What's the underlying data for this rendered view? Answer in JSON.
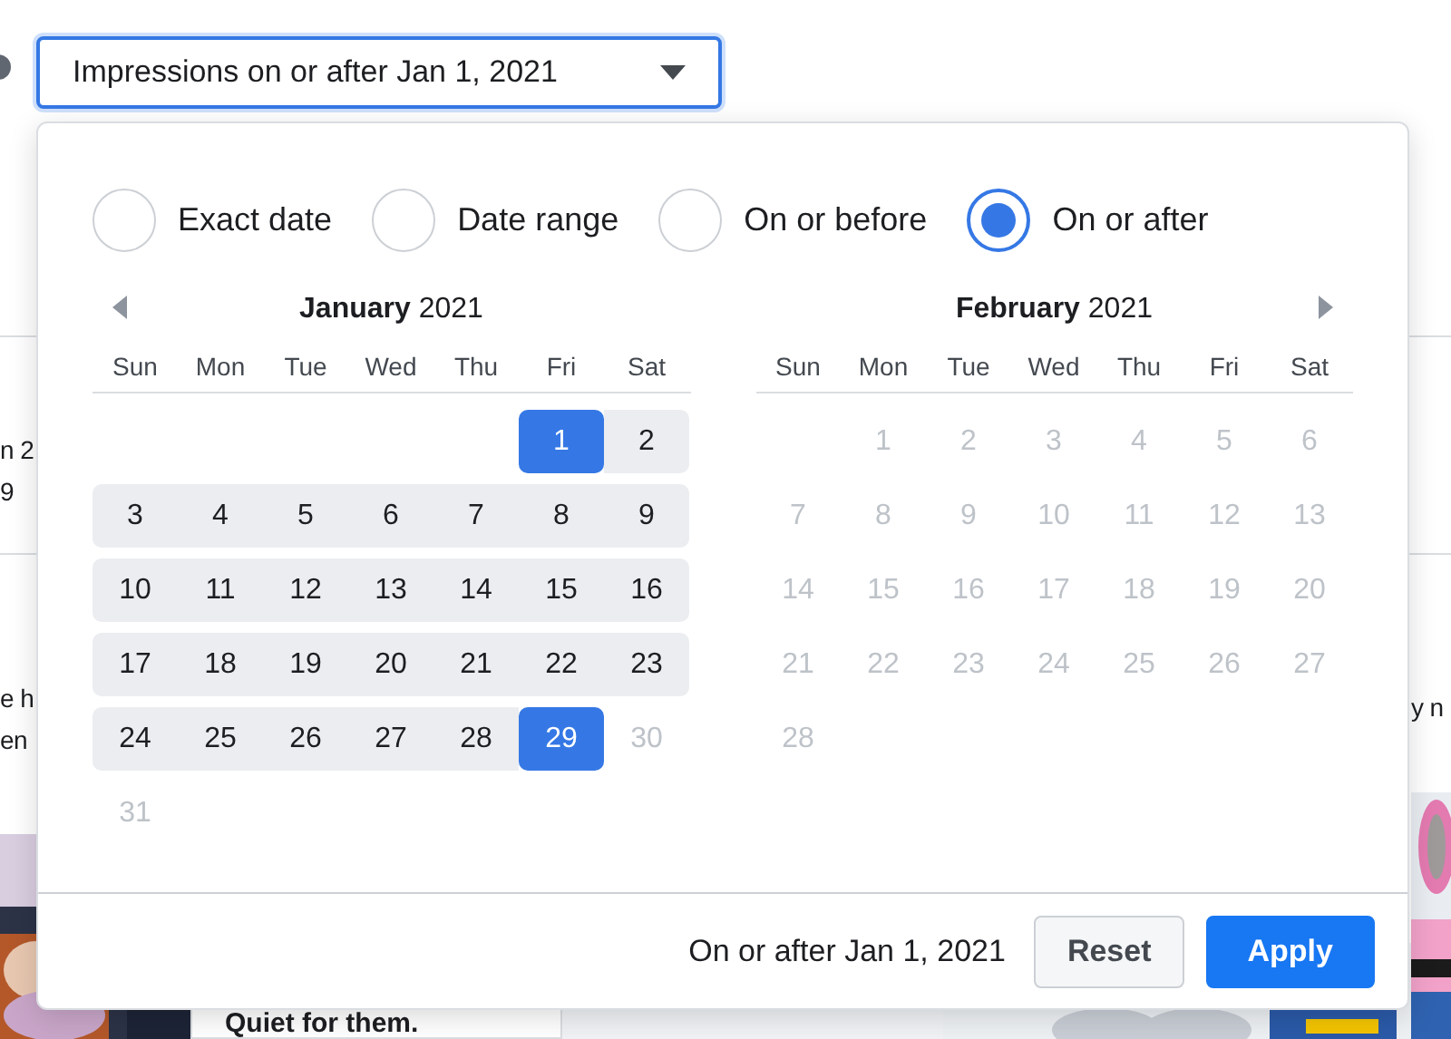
{
  "filter_button": {
    "label": "Impressions on or after Jan 1, 2021"
  },
  "modes": [
    {
      "label": "Exact date",
      "selected": false
    },
    {
      "label": "Date range",
      "selected": false
    },
    {
      "label": "On or before",
      "selected": false
    },
    {
      "label": "On or after",
      "selected": true
    }
  ],
  "calendars": [
    {
      "month": "January",
      "year": "2021",
      "prev_arrow": true,
      "weekdays": [
        "Sun",
        "Mon",
        "Tue",
        "Wed",
        "Thu",
        "Fri",
        "Sat"
      ],
      "weeks": [
        [
          {
            "day": "1",
            "selected": true,
            "disabled": false
          },
          {
            "day": "2",
            "selected": false,
            "disabled": false
          }
        ],
        [
          {
            "day": "3",
            "selected": false,
            "disabled": false
          },
          {
            "day": "4",
            "selected": false,
            "disabled": false
          },
          {
            "day": "5",
            "selected": false,
            "disabled": false
          },
          {
            "day": "6",
            "selected": false,
            "disabled": false
          },
          {
            "day": "7",
            "selected": false,
            "disabled": false
          },
          {
            "day": "8",
            "selected": false,
            "disabled": false
          },
          {
            "day": "9",
            "selected": false,
            "disabled": false
          }
        ],
        [
          {
            "day": "10",
            "selected": false,
            "disabled": false
          },
          {
            "day": "11",
            "selected": false,
            "disabled": false
          },
          {
            "day": "12",
            "selected": false,
            "disabled": false
          },
          {
            "day": "13",
            "selected": false,
            "disabled": false
          },
          {
            "day": "14",
            "selected": false,
            "disabled": false
          },
          {
            "day": "15",
            "selected": false,
            "disabled": false
          },
          {
            "day": "16",
            "selected": false,
            "disabled": false
          }
        ],
        [
          {
            "day": "17",
            "selected": false,
            "disabled": false
          },
          {
            "day": "18",
            "selected": false,
            "disabled": false
          },
          {
            "day": "19",
            "selected": false,
            "disabled": false
          },
          {
            "day": "20",
            "selected": false,
            "disabled": false
          },
          {
            "day": "21",
            "selected": false,
            "disabled": false
          },
          {
            "day": "22",
            "selected": false,
            "disabled": false
          },
          {
            "day": "23",
            "selected": false,
            "disabled": false
          }
        ],
        [
          {
            "day": "24",
            "selected": false,
            "disabled": false
          },
          {
            "day": "25",
            "selected": false,
            "disabled": false
          },
          {
            "day": "26",
            "selected": false,
            "disabled": false
          },
          {
            "day": "27",
            "selected": false,
            "disabled": false
          },
          {
            "day": "28",
            "selected": false,
            "disabled": false
          },
          {
            "day": "29",
            "selected": true,
            "disabled": false
          },
          {
            "day": "30",
            "selected": false,
            "disabled": true
          }
        ],
        [
          {
            "day": "31",
            "selected": false,
            "disabled": true
          }
        ]
      ]
    },
    {
      "month": "February",
      "year": "2021",
      "next_arrow": true,
      "weekdays": [
        "Sun",
        "Mon",
        "Tue",
        "Wed",
        "Thu",
        "Fri",
        "Sat"
      ],
      "weeks": [
        [
          {
            "day": "1",
            "selected": false,
            "disabled": true
          },
          {
            "day": "2",
            "selected": false,
            "disabled": true
          },
          {
            "day": "3",
            "selected": false,
            "disabled": true
          },
          {
            "day": "4",
            "selected": false,
            "disabled": true
          },
          {
            "day": "5",
            "selected": false,
            "disabled": true
          },
          {
            "day": "6",
            "selected": false,
            "disabled": true
          }
        ],
        [
          {
            "day": "7",
            "selected": false,
            "disabled": true
          },
          {
            "day": "8",
            "selected": false,
            "disabled": true
          },
          {
            "day": "9",
            "selected": false,
            "disabled": true
          },
          {
            "day": "10",
            "selected": false,
            "disabled": true
          },
          {
            "day": "11",
            "selected": false,
            "disabled": true
          },
          {
            "day": "12",
            "selected": false,
            "disabled": true
          },
          {
            "day": "13",
            "selected": false,
            "disabled": true
          }
        ],
        [
          {
            "day": "14",
            "selected": false,
            "disabled": true
          },
          {
            "day": "15",
            "selected": false,
            "disabled": true
          },
          {
            "day": "16",
            "selected": false,
            "disabled": true
          },
          {
            "day": "17",
            "selected": false,
            "disabled": true
          },
          {
            "day": "18",
            "selected": false,
            "disabled": true
          },
          {
            "day": "19",
            "selected": false,
            "disabled": true
          },
          {
            "day": "20",
            "selected": false,
            "disabled": true
          }
        ],
        [
          {
            "day": "21",
            "selected": false,
            "disabled": true
          },
          {
            "day": "22",
            "selected": false,
            "disabled": true
          },
          {
            "day": "23",
            "selected": false,
            "disabled": true
          },
          {
            "day": "24",
            "selected": false,
            "disabled": true
          },
          {
            "day": "25",
            "selected": false,
            "disabled": true
          },
          {
            "day": "26",
            "selected": false,
            "disabled": true
          },
          {
            "day": "27",
            "selected": false,
            "disabled": true
          }
        ],
        [
          {
            "day": "28",
            "selected": false,
            "disabled": true
          }
        ]
      ]
    }
  ],
  "footer": {
    "summary": "On or after Jan 1, 2021",
    "buttons": [
      {
        "label": "Reset",
        "kind": "secondary"
      },
      {
        "label": "Apply",
        "kind": "primary"
      }
    ]
  },
  "background": {
    "left_texts": [
      "n 2",
      "9",
      "e h",
      "en"
    ],
    "right_texts": [
      "y n"
    ],
    "card_caption": "Quiet for them."
  }
}
